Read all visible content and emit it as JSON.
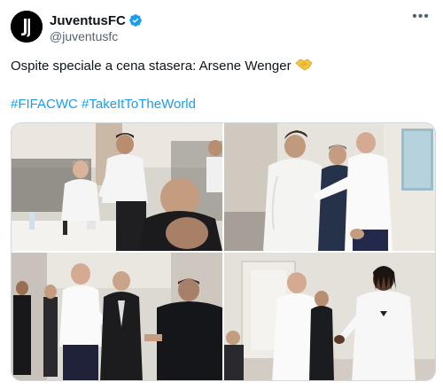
{
  "author": {
    "display_name": "JuventusFC",
    "handle": "@juventusfc",
    "verified": true,
    "avatar_icon": "juventus-logo-icon"
  },
  "more_icon": "more-options-icon",
  "tweet": {
    "text": "Ospite speciale a cena stasera: Arsene Wenger",
    "emoji": "handshake-emoji",
    "hashtags": [
      "#FIFACWC",
      "#TakeItToTheWorld"
    ]
  },
  "media": [
    {
      "name": "photo-dinner-table-greeting"
    },
    {
      "name": "photo-wenger-hug"
    },
    {
      "name": "photo-wenger-staff-handshake"
    },
    {
      "name": "photo-wenger-player-handshake"
    }
  ],
  "colors": {
    "link": "#1d9bf0",
    "verified": "#1d9bf0",
    "secondary_text": "#536471",
    "border": "#cfd9de"
  }
}
